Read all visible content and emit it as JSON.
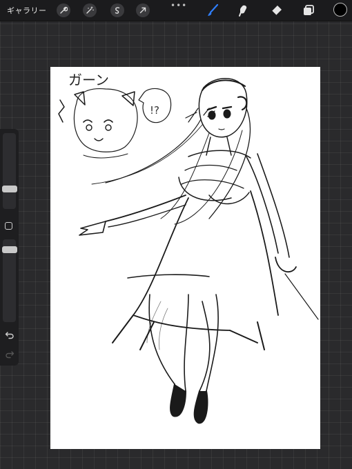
{
  "toolbar": {
    "gallery_label": "ギャラリー",
    "left_tools": [
      "wrench-icon",
      "magic-wand-icon",
      "selection-icon",
      "transform-arrow-icon"
    ],
    "more_label": "•••",
    "right_tools": [
      "brush-icon",
      "smudge-icon",
      "eraser-icon",
      "layers-icon"
    ],
    "active_tool": "brush-icon",
    "accent_color": "#2f7fff",
    "current_color": "#000000"
  },
  "sidebar": {
    "brush_size_level": 0.45,
    "opacity_level": 0.2,
    "controls": [
      "brush-size-slider",
      "modify-button",
      "opacity-slider",
      "undo-icon",
      "redo-icon"
    ]
  },
  "canvas": {
    "sketch_text": "ガーン",
    "bubble_text": "!?"
  }
}
